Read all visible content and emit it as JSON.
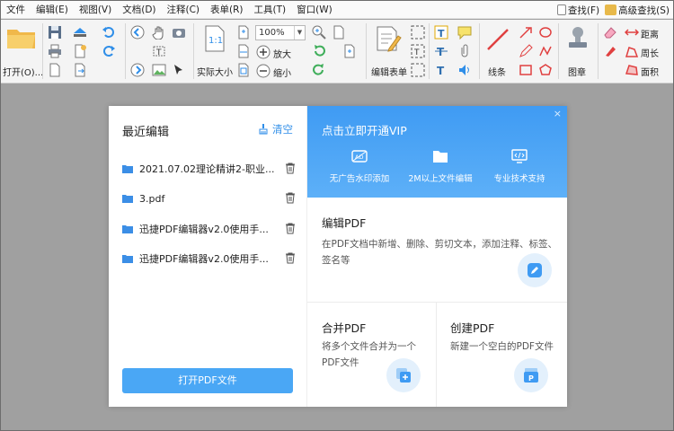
{
  "menu": {
    "items": [
      "文件",
      "编辑(E)",
      "视图(V)",
      "文档(D)",
      "注释(C)",
      "表单(R)",
      "工具(T)",
      "窗口(W)"
    ],
    "find_label": "查找(F)",
    "advanced_find_label": "高级查找(S)"
  },
  "toolbar": {
    "open_label": "打开(O)...",
    "actual_size_label": "实际大小",
    "zoom_value": "100%",
    "zoom_in_label": "放大",
    "zoom_out_label": "缩小",
    "edit_form_label": "编辑表单",
    "line_label": "线条",
    "stamp_label": "图章",
    "distance_label": "距离",
    "perimeter_label": "周长",
    "area_label": "面积"
  },
  "recent": {
    "title": "最近编辑",
    "clear_label": "清空",
    "files": [
      "2021.07.02理论精讲2-职业...",
      "3.pdf",
      "迅捷PDF编辑器v2.0使用手...",
      "迅捷PDF编辑器v2.0使用手..."
    ],
    "open_button_label": "打开PDF文件"
  },
  "vip": {
    "title": "点击立即开通VIP",
    "close": "×",
    "features": [
      "无广告水印添加",
      "2M以上文件编辑",
      "专业技术支持"
    ]
  },
  "cards": {
    "edit": {
      "title": "编辑PDF",
      "desc": "在PDF文档中新增、删除、剪切文本，添加注释、标签、签名等"
    },
    "merge": {
      "title": "合并PDF",
      "desc": "将多个文件合并为一个PDF文件"
    },
    "create": {
      "title": "创建PDF",
      "desc": "新建一个空白的PDF文件"
    }
  },
  "colors": {
    "accent": "#4aa7f5",
    "link": "#2f8ee8",
    "vip_bg": "#3f9bf3",
    "canvas_bg": "#a0a0a0",
    "folder": "#3b8ee6"
  }
}
